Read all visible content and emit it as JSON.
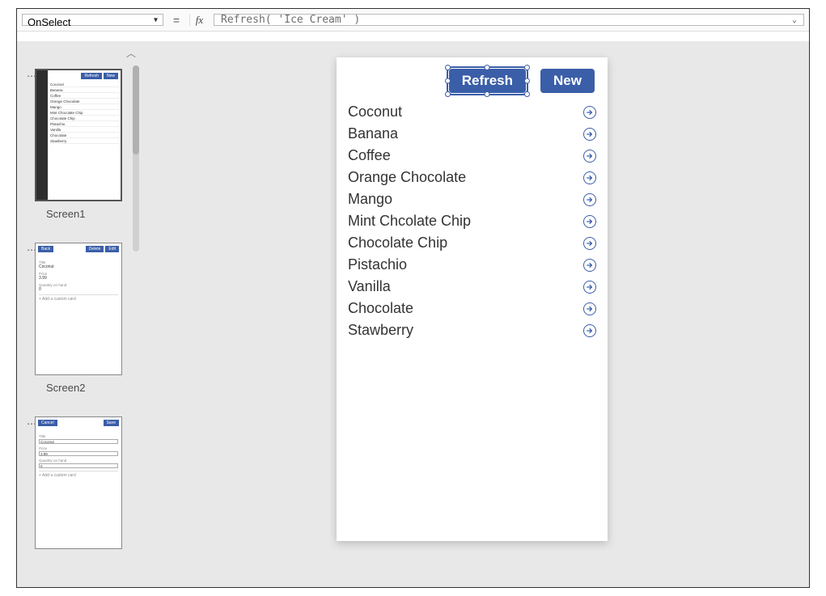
{
  "formula_bar": {
    "property": "OnSelect",
    "fx_label": "fx",
    "equals": "=",
    "formula": "Refresh( 'Ice Cream' )"
  },
  "thumbnails": {
    "screen1": {
      "label": "Screen1",
      "buttons": {
        "refresh": "Refresh",
        "new": "New"
      },
      "items": [
        "Coconut",
        "Banana",
        "Coffee",
        "Orange Chocolate",
        "Mango",
        "Mint Chocolate Chip",
        "Chocolate Chip",
        "Pistachio",
        "Vanilla",
        "Chocolate",
        "Stawberry"
      ]
    },
    "screen2": {
      "label": "Screen2",
      "buttons": {
        "back": "Back",
        "delete": "Delete",
        "edit": "Edit"
      },
      "fields": {
        "title_label": "Title",
        "title_val": "Coconut",
        "price_label": "Price",
        "price_val": "3.99",
        "qty_label": "Quantity on hand",
        "qty_val": "0",
        "add_card": "+  Add a custom card"
      }
    },
    "screen3": {
      "buttons": {
        "cancel": "Cancel",
        "save": "Save"
      },
      "fields": {
        "title_label": "Title",
        "title_val": "Coconut",
        "price_label": "Price",
        "price_val": "3.99",
        "qty_label": "Quantity on hand",
        "qty_val": "0",
        "add_card": "+  Add a custom card"
      }
    }
  },
  "canvas": {
    "buttons": {
      "refresh": "Refresh",
      "new": "New"
    },
    "items": [
      "Coconut",
      "Banana",
      "Coffee",
      "Orange Chocolate",
      "Mango",
      "Mint Chcolate Chip",
      "Chocolate Chip",
      "Pistachio",
      "Vanilla",
      "Chocolate",
      "Stawberry"
    ]
  }
}
